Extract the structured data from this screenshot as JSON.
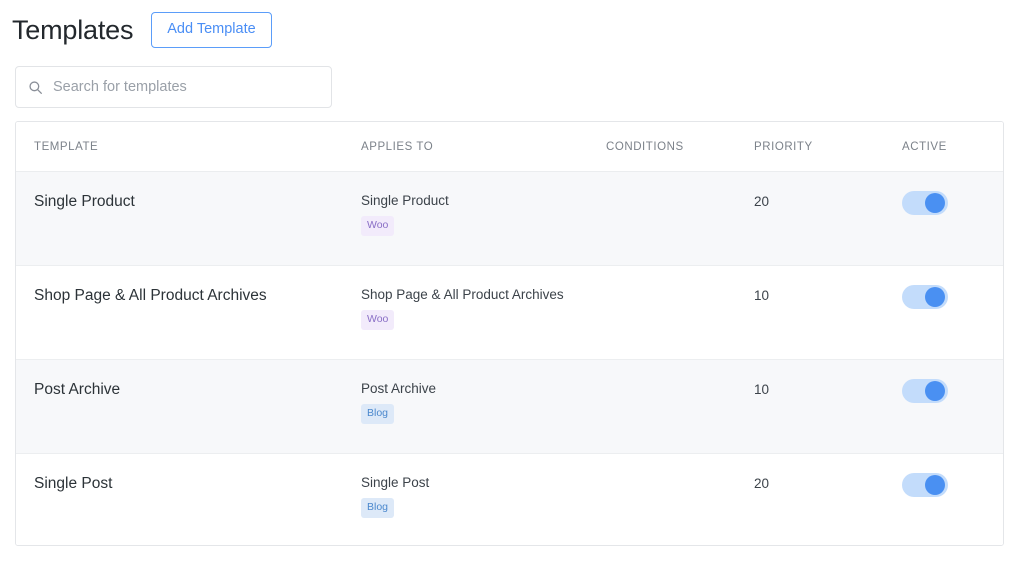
{
  "header": {
    "title": "Templates",
    "add_button_label": "Add Template"
  },
  "search": {
    "placeholder": "Search for templates",
    "value": "",
    "icon": "search-icon"
  },
  "table": {
    "columns": [
      {
        "key": "template",
        "label": "TEMPLATE"
      },
      {
        "key": "applies_to",
        "label": "APPLIES TO"
      },
      {
        "key": "conditions",
        "label": "CONDITIONS"
      },
      {
        "key": "priority",
        "label": "PRIORITY"
      },
      {
        "key": "active",
        "label": "ACTIVE"
      }
    ],
    "rows": [
      {
        "template": "Single Product",
        "applies_to": "Single Product",
        "badge": "Woo",
        "badge_type": "woo",
        "conditions": "",
        "priority": "20",
        "active": true
      },
      {
        "template": "Shop Page & All Product Archives",
        "applies_to": "Shop Page & All Product Archives",
        "badge": "Woo",
        "badge_type": "woo",
        "conditions": "",
        "priority": "10",
        "active": true
      },
      {
        "template": "Post Archive",
        "applies_to": "Post Archive",
        "badge": "Blog",
        "badge_type": "blog",
        "conditions": "",
        "priority": "10",
        "active": true
      },
      {
        "template": "Single Post",
        "applies_to": "Single Post",
        "badge": "Blog",
        "badge_type": "blog",
        "conditions": "",
        "priority": "20",
        "active": true
      }
    ]
  },
  "colors": {
    "accent_blue": "#4a8ef5",
    "toggle_track": "#c3dcfb",
    "toggle_knob": "#4a90f2",
    "badge_woo_bg": "#f2ebfb",
    "badge_woo_text": "#8a6fc6",
    "badge_blog_bg": "#dde9f8",
    "badge_blog_text": "#4b88cd",
    "row_alt_bg": "#f7f8fa",
    "border": "#e4e6e9"
  }
}
